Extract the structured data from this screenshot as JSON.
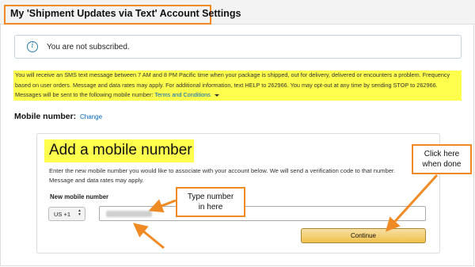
{
  "page": {
    "title": "My 'Shipment Updates via Text' Account Settings"
  },
  "alert": {
    "icon": "info-icon",
    "message": "You are not subscribed."
  },
  "disclaimer": {
    "text": "You will receive an SMS text message between 7 AM and 8 PM Pacific time when your package is shipped, out for delivery, delivered or encounters a problem. Frequency based on user orders. Message and data rates may apply. For additional information, text HELP to 262966. You may opt-out at any time by sending STOP to 262966. Messages will be sent to the following mobile number: ",
    "terms_link": "Terms and Conditions"
  },
  "mobile": {
    "label": "Mobile number:",
    "change_link": "Change"
  },
  "add_form": {
    "title": "Add a mobile number",
    "instructions": "Enter the new mobile number you would like to associate with your account below. We will send a verification code to that number. Message and data rates may apply.",
    "field_label": "New mobile number",
    "country_code": "US +1",
    "phone_value": "",
    "continue_label": "Continue"
  },
  "annotations": {
    "type_number": [
      "Type number",
      "in here"
    ],
    "click_here": [
      "Click here",
      "when done"
    ]
  },
  "colors": {
    "highlight": "#ffff4d",
    "annotation_orange": "#f08a24",
    "link": "#0066c0",
    "button": "#f0c14b"
  }
}
